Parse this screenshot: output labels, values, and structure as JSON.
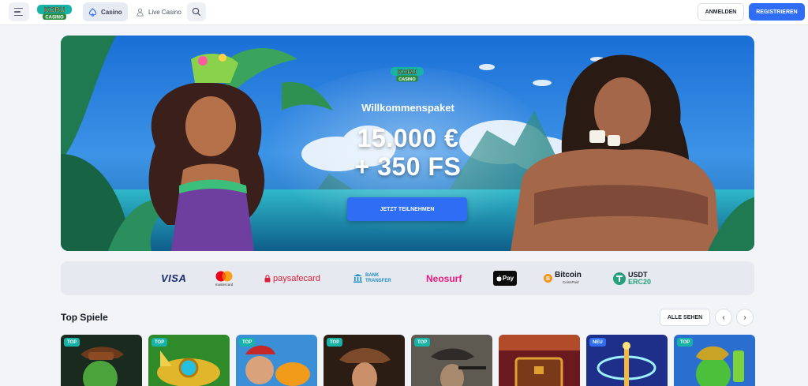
{
  "header": {
    "logo_text": "KORU CASINO",
    "tabs": [
      {
        "label": "Casino",
        "icon": "spade-icon"
      },
      {
        "label": "Live Casino",
        "icon": "dealer-icon"
      }
    ],
    "login_label": "ANMELDEN",
    "register_label": "REGISTRIEREN"
  },
  "hero": {
    "logo_text": "KORU CASINO",
    "kicker": "Willkommenspaket",
    "amount": "15.000 €",
    "spins": "+ 350 FS",
    "cta_label": "JETZT TEILNEHMEN"
  },
  "payments": [
    {
      "name": "VISA"
    },
    {
      "name": "mastercard"
    },
    {
      "name": "paysafecard"
    },
    {
      "name": "BANK TRANSFER"
    },
    {
      "name": "Neosurf"
    },
    {
      "name": "Pay"
    },
    {
      "name": "Bitcoin",
      "sub": "CoinsPaid"
    },
    {
      "name": "USDT",
      "sub": "ERC20"
    }
  ],
  "top_games": {
    "title": "Top Spiele",
    "see_all_label": "ALLE SEHEN",
    "prev_icon": "‹",
    "next_icon": "›",
    "games": [
      {
        "badge": "TOP"
      },
      {
        "badge": "TOP"
      },
      {
        "badge": "TOP"
      },
      {
        "badge": "TOP"
      },
      {
        "badge": "TOP"
      },
      {
        "badge": ""
      },
      {
        "badge": "NEU"
      },
      {
        "badge": "TOP"
      }
    ]
  },
  "colors": {
    "accent": "#2f6df5",
    "badge_top": "#17b3a6",
    "page_bg": "#f2f4f8"
  }
}
